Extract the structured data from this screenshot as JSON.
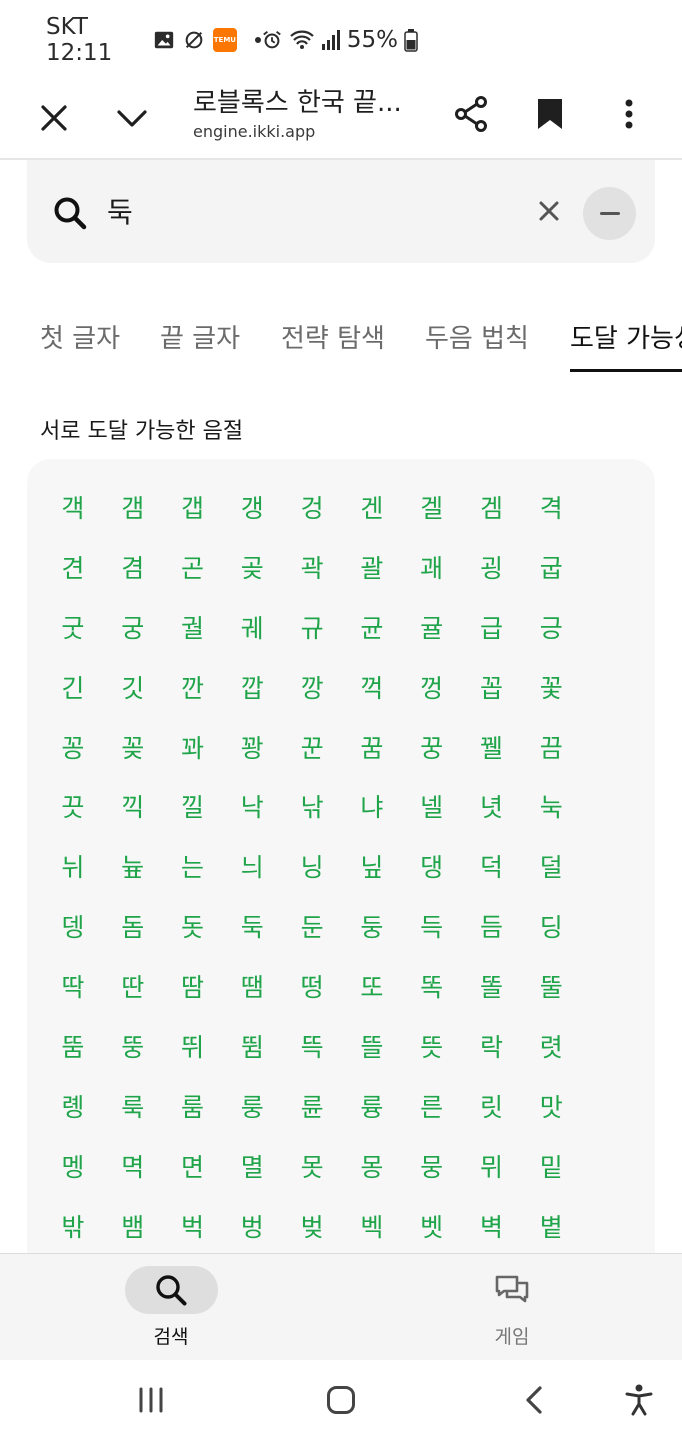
{
  "status_bar": {
    "time": "SKT 12:11",
    "temu_label": "TEMU",
    "battery": "55%"
  },
  "browser": {
    "title": "로블록스 한국 끝...",
    "url": "engine.ikki.app"
  },
  "search": {
    "value": "둑",
    "placeholder": ""
  },
  "tabs": [
    {
      "label": "첫 글자",
      "active": false
    },
    {
      "label": "끝 글자",
      "active": false
    },
    {
      "label": "전략 탐색",
      "active": false
    },
    {
      "label": "두음 법칙",
      "active": false
    },
    {
      "label": "도달 가능성",
      "active": true
    }
  ],
  "section": {
    "title": "서로 도달 가능한 음절",
    "syllables": [
      "객",
      "갬",
      "갭",
      "갱",
      "겅",
      "겐",
      "겔",
      "겜",
      "격",
      "견",
      "겸",
      "곤",
      "곶",
      "곽",
      "괄",
      "괘",
      "굉",
      "굽",
      "굿",
      "궁",
      "궐",
      "궤",
      "규",
      "균",
      "귤",
      "급",
      "긍",
      "긴",
      "깃",
      "깐",
      "깝",
      "깡",
      "꺽",
      "껑",
      "꼽",
      "꽃",
      "꽁",
      "꽂",
      "꽈",
      "꽝",
      "꾼",
      "꿈",
      "꿍",
      "꿸",
      "끔",
      "끗",
      "끽",
      "낄",
      "낙",
      "낚",
      "냐",
      "넬",
      "녓",
      "눅",
      "뉘",
      "늎",
      "는",
      "늬",
      "닝",
      "닢",
      "댕",
      "덕",
      "덜",
      "뎅",
      "돔",
      "돗",
      "둑",
      "둔",
      "둥",
      "득",
      "듬",
      "딩",
      "딱",
      "딴",
      "땀",
      "땜",
      "떵",
      "또",
      "똑",
      "똘",
      "뚤",
      "뚬",
      "뚱",
      "뛰",
      "뜀",
      "뜩",
      "뜰",
      "뜻",
      "락",
      "렷",
      "롕",
      "룩",
      "룸",
      "룽",
      "륜",
      "륭",
      "른",
      "릿",
      "맛",
      "멩",
      "멱",
      "면",
      "멸",
      "못",
      "몽",
      "뭉",
      "뮈",
      "밑",
      "밖",
      "뱀",
      "벅",
      "벙",
      "벚",
      "벡",
      "벳",
      "벽",
      "볕"
    ]
  },
  "bottom_nav": {
    "search_label": "검색",
    "game_label": "게임"
  }
}
